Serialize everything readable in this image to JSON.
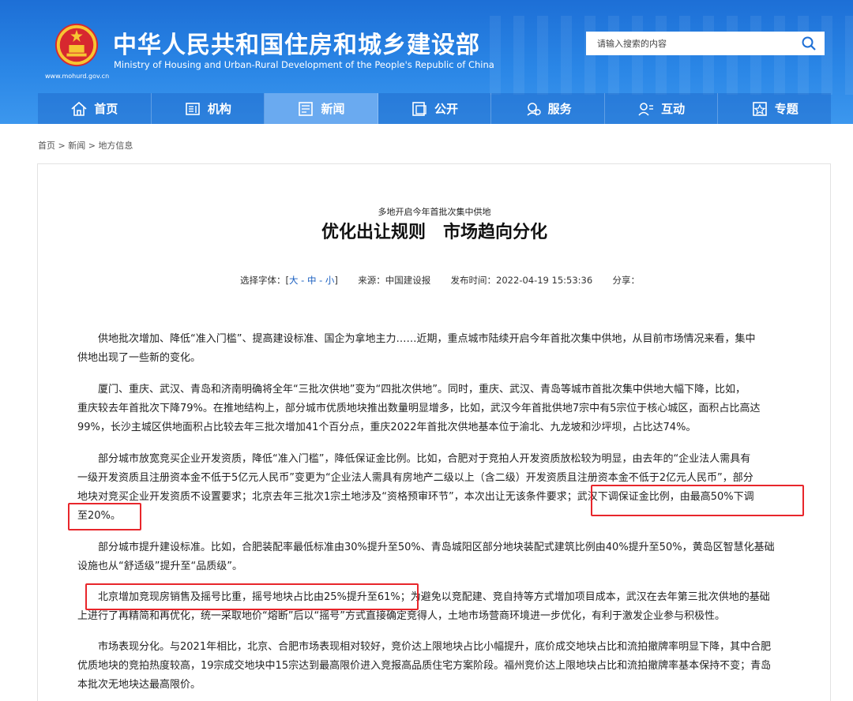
{
  "header": {
    "title_cn": "中华人民共和国住房和城乡建设部",
    "title_en": "Ministry of Housing and Urban-Rural Development of the People's Republic of China",
    "site_url": "www.mohurd.gov.cn",
    "search_placeholder": "请输入搜索的内容"
  },
  "nav": {
    "items": [
      {
        "label": "首页",
        "icon": "home-icon"
      },
      {
        "label": "机构",
        "icon": "org-icon"
      },
      {
        "label": "新闻",
        "icon": "news-icon",
        "active": true
      },
      {
        "label": "公开",
        "icon": "public-icon"
      },
      {
        "label": "服务",
        "icon": "service-icon"
      },
      {
        "label": "互动",
        "icon": "interaction-icon"
      },
      {
        "label": "专题",
        "icon": "topic-icon"
      }
    ]
  },
  "breadcrumb": {
    "items": [
      "首页",
      "新闻",
      "地方信息"
    ],
    "separator": ">"
  },
  "article": {
    "subtitle": "多地开启今年首批次集中供地",
    "title": "优化出让规则　市场趋向分化",
    "font_label": "选择字体：[",
    "font_options": "大 - 中 - 小",
    "font_close": "]",
    "source": "来源：中国建设报",
    "publish_time": "发布时间：2022-04-19 15:53:36",
    "share": "分享：",
    "paragraphs": [
      [
        "　　供地批次增加、降低“准入门槛”、提高建设标准、国企为拿地主力……近期，重点城市陆续开启今年首批次集中供地，从目前市场情况来看，集中",
        "供地出现了一些新的变化。"
      ],
      [
        "　　厦门、重庆、武汉、青岛和济南明确将全年“三批次供地”变为“四批次供地”。同时，重庆、武汉、青岛等城市首批次集中供地大幅下降，比如，",
        "重庆较去年首批次下降79%。在推地结构上，部分城市优质地块推出数量明显增多，比如，武汉今年首批供地7宗中有5宗位于核心城区，面积占比高达",
        "99%，长沙主城区供地面积占比较去年三批次增加41个百分点，重庆2022年首批次供地基本位于渝北、九龙坡和沙坪坝，占比达74%。"
      ],
      [
        "　　部分城市放宽竞买企业开发资质，降低“准入门槛”，降低保证金比例。比如，合肥对于竞拍人开发资质放松较为明显，由去年的“企业法人需具有",
        "一级开发资质且注册资本金不低于5亿元人民币”变更为“企业法人需具有房地产二级以上（含二级）开发资质且注册资本金不低于2亿元人民币”，部分",
        "地块对竞买企业开发资质不设置要求；北京去年三批次1宗土地涉及“资格预审环节”，本次出让无该条件要求；武汉下调保证金比例，由最高50%下调",
        "至20%。"
      ],
      [
        "　　部分城市提升建设标准。比如，合肥装配率最低标准由30%提升至50%、青岛城阳区部分地块装配式建筑比例由40%提升至50%，黄岛区智慧化基础",
        "设施也从“舒适级”提升至“品质级”。"
      ],
      [
        "　　北京增加竞现房销售及摇号比重，摇号地块占比由25%提升至61%；为避免以竞配建、竞自持等方式增加项目成本，武汉在去年第三批次供地的基础",
        "上进行了再精简和再优化，统一采取地价“熔断”后以“摇号”方式直接确定竞得人，土地市场营商环境进一步优化，有利于激发企业参与积极性。"
      ],
      [
        "　　市场表现分化。与2021年相比，北京、合肥市场表现相对较好，竞价达上限地块占比小幅提升，底价成交地块占比和流拍撤牌率明显下降，其中合肥",
        "优质地块的竞拍热度较高，19宗成交地块中15宗达到最高限价进入竞报高品质住宅方案阶段。福州竞价达上限地块占比和流拍撤牌率基本保持不变；青岛",
        "本批次无地块达最高限价。"
      ]
    ]
  },
  "colors": {
    "header_blue": "#1d6fd6",
    "nav_active": "#6aaaf0",
    "highlight_red": "#e8262b",
    "link_blue": "#1a5fc0"
  }
}
